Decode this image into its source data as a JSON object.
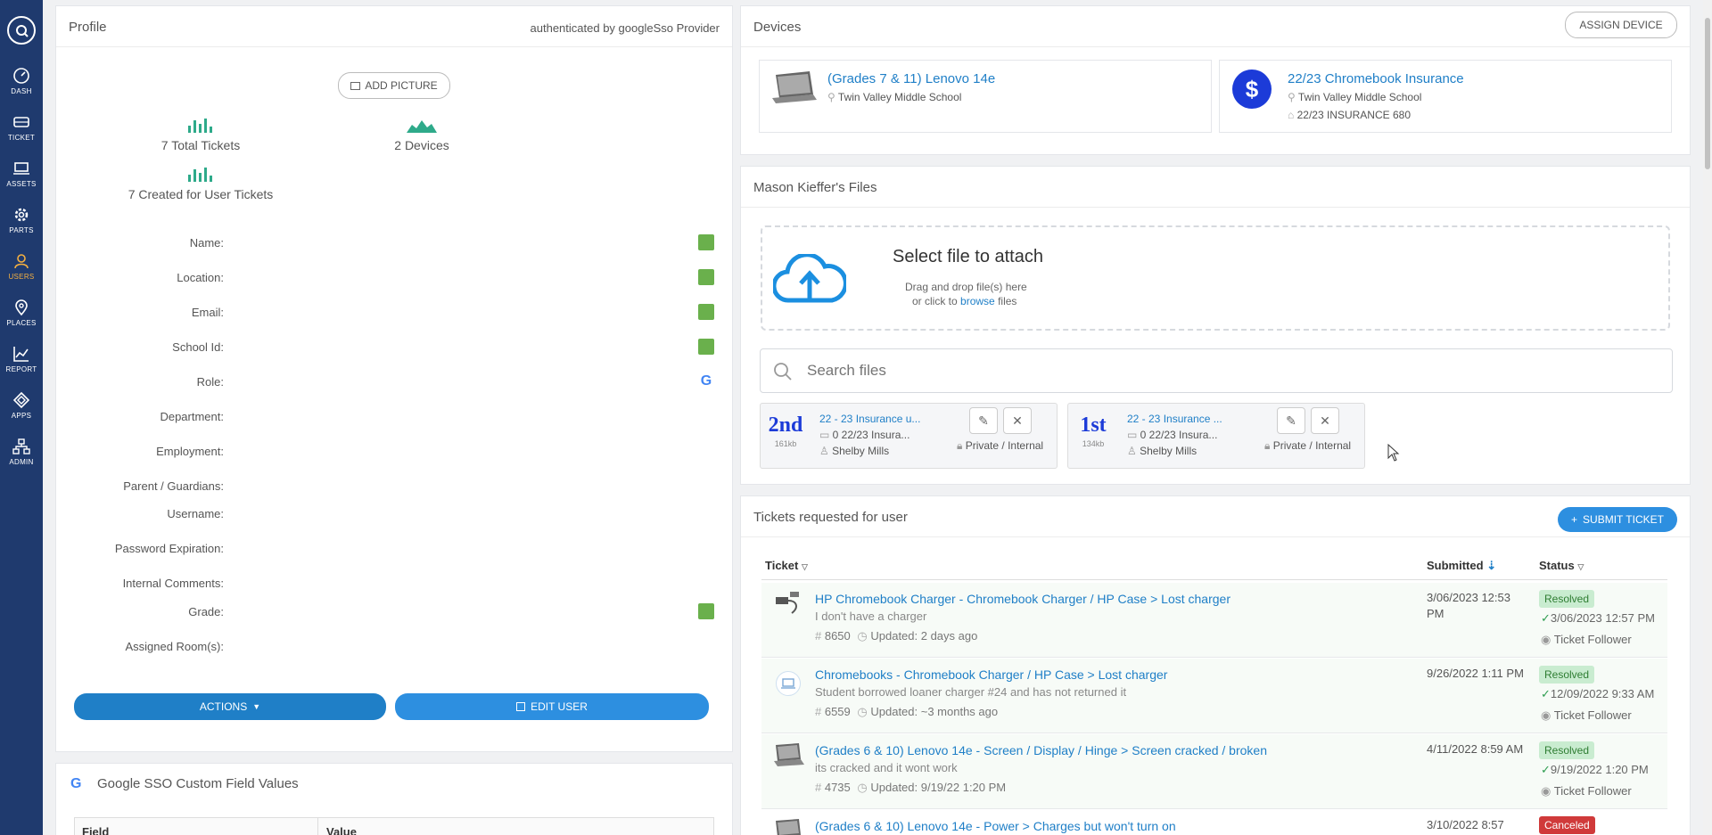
{
  "sidebar": {
    "items": [
      {
        "label": "DASH",
        "icon": "dashboard-icon"
      },
      {
        "label": "TICKET",
        "icon": "ticket-icon"
      },
      {
        "label": "ASSETS",
        "icon": "laptop-icon"
      },
      {
        "label": "PARTS",
        "icon": "gear-icon"
      },
      {
        "label": "USERS",
        "icon": "user-icon"
      },
      {
        "label": "PLACES",
        "icon": "map-pin-icon"
      },
      {
        "label": "REPORT",
        "icon": "chart-icon"
      },
      {
        "label": "APPS",
        "icon": "apps-icon"
      },
      {
        "label": "ADMIN",
        "icon": "org-chart-icon"
      }
    ]
  },
  "profile": {
    "title": "Profile",
    "auth": "authenticated by googleSso Provider",
    "add_picture": "ADD PICTURE",
    "stats": {
      "total_tickets": "7 Total Tickets",
      "devices": "2 Devices",
      "created": "7 Created for User Tickets"
    },
    "fields": [
      "Name:",
      "Location:",
      "Email:",
      "School Id:",
      "Role:",
      "Department:",
      "Employment:",
      "Parent / Guardians:",
      "Username:",
      "Password Expiration:",
      "Internal Comments:",
      "Grade:",
      "Assigned Room(s):"
    ],
    "actions_label": "ACTIONS",
    "edit_label": "EDIT USER"
  },
  "sso": {
    "title": "Google SSO Custom Field Values",
    "col_field": "Field",
    "col_value": "Value"
  },
  "devices": {
    "title": "Devices",
    "assign": "ASSIGN DEVICE",
    "items": [
      {
        "name": "(Grades 7 & 11) Lenovo 14e",
        "location": "Twin Valley Middle School"
      },
      {
        "name": "22/23 Chromebook Insurance",
        "location": "Twin Valley Middle School",
        "tag": "22/23 INSURANCE 680"
      }
    ]
  },
  "files": {
    "title": "Mason Kieffer's Files",
    "select": "Select file to attach",
    "drag": "Drag and drop file(s) here",
    "or_click": "or click to",
    "browse": "browse",
    "files_word": "files",
    "search_placeholder": "Search files",
    "items": [
      {
        "thumb": "2nd",
        "size": "161kb",
        "name": "22 - 23 Insurance u...",
        "folder": "0 22/23 Insura...",
        "owner": "Shelby Mills",
        "privacy": "Private / Internal"
      },
      {
        "thumb": "1st",
        "size": "134kb",
        "name": "22 - 23 Insurance ...",
        "folder": "0 22/23 Insura...",
        "owner": "Shelby Mills",
        "privacy": "Private / Internal"
      }
    ]
  },
  "tickets": {
    "title": "Tickets requested for user",
    "submit": "SUBMIT TICKET",
    "col_ticket": "Ticket",
    "col_submitted": "Submitted",
    "col_status": "Status",
    "follower": "Ticket Follower",
    "rows": [
      {
        "title": "HP Chromebook Charger - Chromebook Charger / HP Case > Lost charger",
        "desc": "I don't have a charger",
        "num": "8650",
        "updated": "Updated: 2 days ago",
        "submitted": "3/06/2023 12:53 PM",
        "status": "Resolved",
        "resolved": "3/06/2023 12:57 PM"
      },
      {
        "title": "Chromebooks - Chromebook Charger / HP Case > Lost charger",
        "desc": "Student borrowed loaner charger #24 and has not returned it",
        "num": "6559",
        "updated": "Updated: ~3 months ago",
        "submitted": "9/26/2022 1:11 PM",
        "status": "Resolved",
        "resolved": "12/09/2022 9:33 AM"
      },
      {
        "title": "(Grades 6 & 10) Lenovo 14e - Screen / Display / Hinge > Screen cracked / broken",
        "desc": "its cracked and it wont work",
        "num": "4735",
        "updated": "Updated: 9/19/22 1:20 PM",
        "submitted": "4/11/2022 8:59 AM",
        "status": "Resolved",
        "resolved": "9/19/2022 1:20 PM"
      },
      {
        "title": "(Grades 6 & 10) Lenovo 14e - Power > Charges but won't turn on",
        "submitted": "3/10/2022 8:57",
        "status": "Canceled"
      }
    ]
  }
}
